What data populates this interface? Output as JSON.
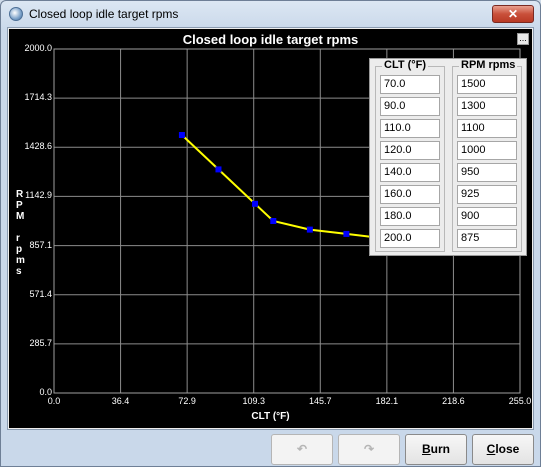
{
  "window": {
    "title": "Closed loop idle target rpms",
    "close_icon": "close-x-icon",
    "app_icon": "app-globe-icon"
  },
  "chart_data": {
    "type": "line",
    "title": "Closed loop idle target rpms",
    "xlabel": "CLT (°F)",
    "ylabel": "RPM rpms",
    "xlim": [
      0.0,
      255.0
    ],
    "ylim": [
      0.0,
      2000.0
    ],
    "x_ticks": [
      "0.0",
      "36.4",
      "72.9",
      "109.3",
      "145.7",
      "182.1",
      "218.6",
      "255.0"
    ],
    "y_ticks": [
      "0.0",
      "285.7",
      "571.4",
      "857.1",
      "1142.9",
      "1428.6",
      "1714.3",
      "2000.0"
    ],
    "grid": true,
    "line_color": "#ffff00",
    "point_color": "#0000ff",
    "background": "#000000",
    "series": [
      {
        "x": [
          70,
          90,
          110,
          120,
          140,
          160,
          180,
          200
        ],
        "values": [
          1500,
          1300,
          1100,
          1000,
          950,
          925,
          900,
          875
        ]
      }
    ]
  },
  "table": {
    "clt_header": "CLT (°F)",
    "rpm_header": "RPM rpms",
    "clt_values": [
      "70.0",
      "90.0",
      "110.0",
      "120.0",
      "140.0",
      "160.0",
      "180.0",
      "200.0"
    ],
    "rpm_values": [
      "1500",
      "1300",
      "1100",
      "1000",
      "950",
      "925",
      "900",
      "875"
    ]
  },
  "chart_menu_label": "...",
  "buttons": {
    "undo_icon": "undo-arrow-icon",
    "redo_icon": "redo-arrow-icon",
    "burn_first": "B",
    "burn_rest": "urn",
    "close_first": "C",
    "close_rest": "lose"
  }
}
